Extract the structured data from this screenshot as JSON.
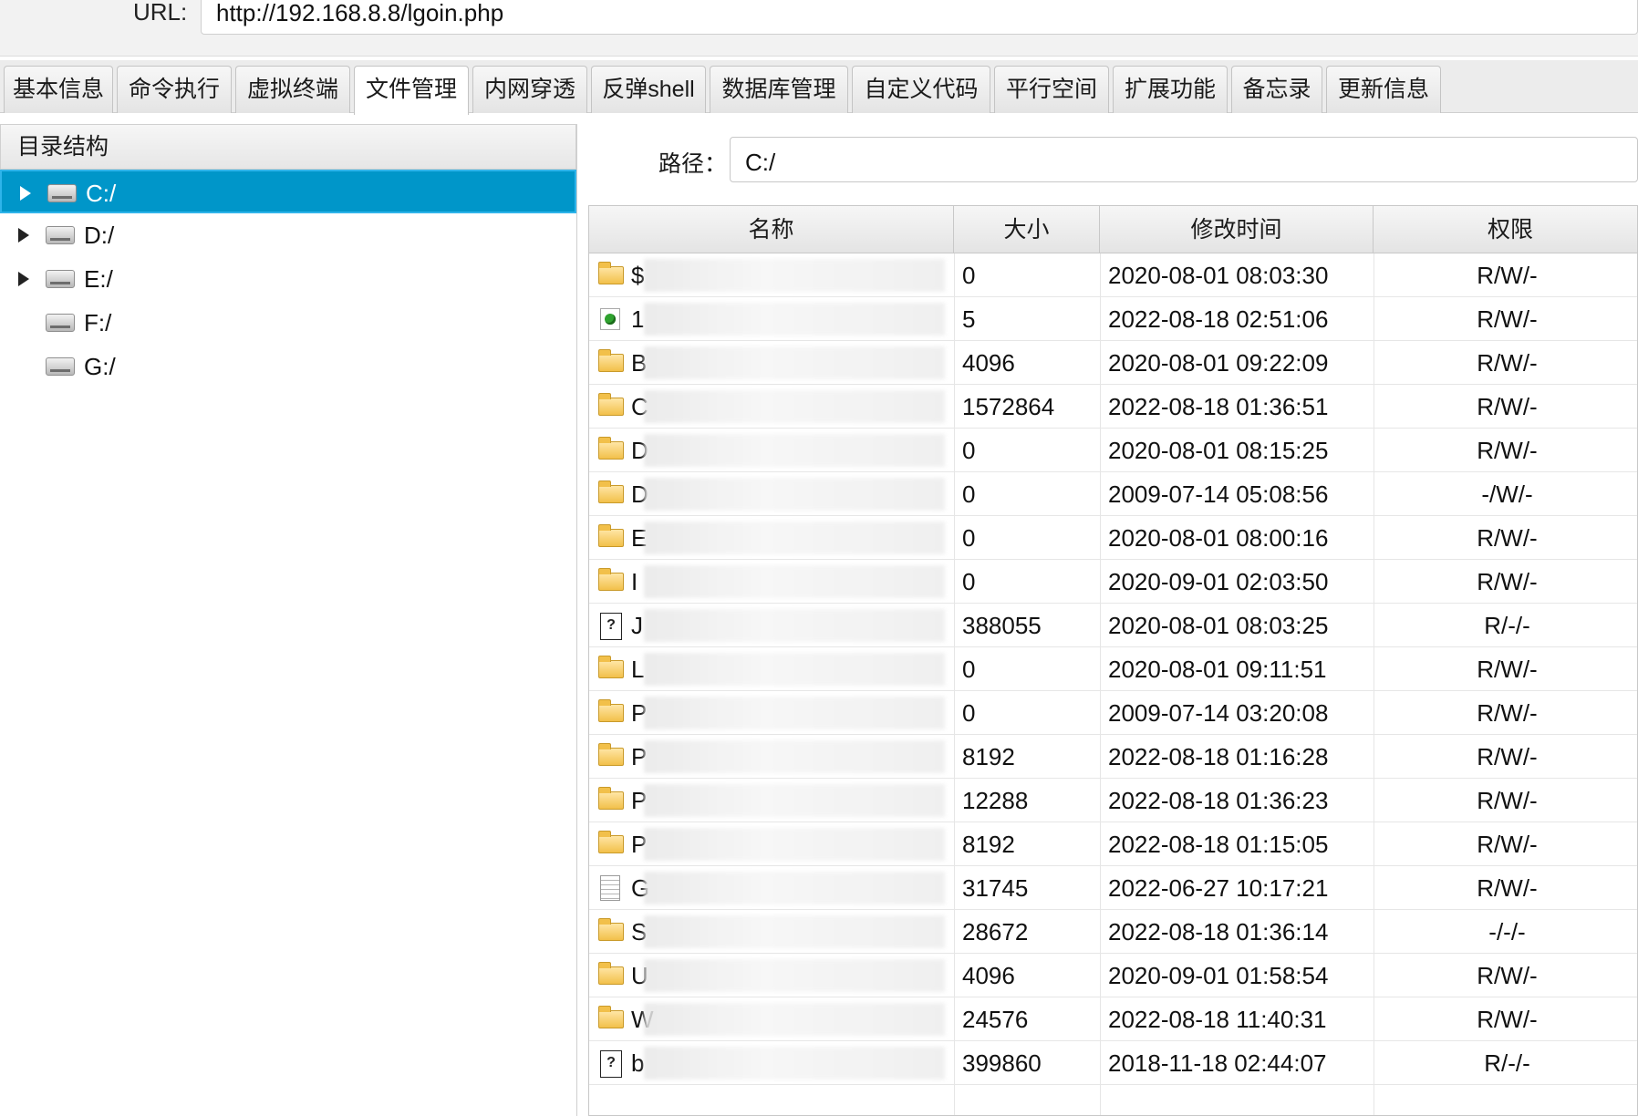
{
  "url_bar": {
    "label": "URL:",
    "value": "http://192.168.8.8/lgoin.php"
  },
  "tabs": [
    {
      "label": "基本信息"
    },
    {
      "label": "命令执行"
    },
    {
      "label": "虚拟终端"
    },
    {
      "label": "文件管理",
      "active": true
    },
    {
      "label": "内网穿透"
    },
    {
      "label": "反弹shell"
    },
    {
      "label": "数据库管理"
    },
    {
      "label": "自定义代码"
    },
    {
      "label": "平行空间"
    },
    {
      "label": "扩展功能"
    },
    {
      "label": "备忘录"
    },
    {
      "label": "更新信息"
    }
  ],
  "tree": {
    "header": "目录结构",
    "items": [
      {
        "label": "C:/",
        "selected": true,
        "expandable": true
      },
      {
        "label": "D:/",
        "expandable": true
      },
      {
        "label": "E:/",
        "expandable": true
      },
      {
        "label": "F:/",
        "expandable": false
      },
      {
        "label": "G:/",
        "expandable": false
      }
    ]
  },
  "path": {
    "label": "路径：",
    "value": "C:/"
  },
  "table": {
    "columns": [
      "名称",
      "大小",
      "修改时间",
      "权限"
    ],
    "rows": [
      {
        "icon": "folder-icon",
        "name": "$",
        "size": "0",
        "time": "2020-08-01 08:03:30",
        "perm": "R/W/-"
      },
      {
        "icon": "green-file-icon",
        "name": "1",
        "size": "5",
        "time": "2022-08-18 02:51:06",
        "perm": "R/W/-"
      },
      {
        "icon": "folder-icon",
        "name": "B",
        "size": "4096",
        "time": "2020-08-01 09:22:09",
        "perm": "R/W/-"
      },
      {
        "icon": "folder-icon",
        "name": "C",
        "size": "1572864",
        "time": "2022-08-18 01:36:51",
        "perm": "R/W/-"
      },
      {
        "icon": "folder-icon",
        "name": "D",
        "size": "0",
        "time": "2020-08-01 08:15:25",
        "perm": "R/W/-"
      },
      {
        "icon": "folder-icon",
        "name": "D",
        "size": "0",
        "time": "2009-07-14 05:08:56",
        "perm": "-/W/-"
      },
      {
        "icon": "folder-icon",
        "name": "E",
        "size": "0",
        "time": "2020-08-01 08:00:16",
        "perm": "R/W/-"
      },
      {
        "icon": "folder-icon",
        "name": "I",
        "size": "0",
        "time": "2020-09-01 02:03:50",
        "perm": "R/W/-"
      },
      {
        "icon": "unknown-file-icon",
        "name": "J",
        "size": "388055",
        "time": "2020-08-01 08:03:25",
        "perm": "R/-/-"
      },
      {
        "icon": "folder-icon",
        "name": "L",
        "size": "0",
        "time": "2020-08-01 09:11:51",
        "perm": "R/W/-"
      },
      {
        "icon": "folder-icon",
        "name": "P",
        "size": "0",
        "time": "2009-07-14 03:20:08",
        "perm": "R/W/-"
      },
      {
        "icon": "folder-icon",
        "name": "P",
        "size": "8192",
        "time": "2022-08-18 01:16:28",
        "perm": "R/W/-"
      },
      {
        "icon": "folder-icon",
        "name": "P",
        "size": "12288",
        "time": "2022-08-18 01:36:23",
        "perm": "R/W/-"
      },
      {
        "icon": "folder-icon",
        "name": "P",
        "size": "8192",
        "time": "2022-08-18 01:15:05",
        "perm": "R/W/-"
      },
      {
        "icon": "text-file-icon",
        "name": "G",
        "size": "31745",
        "time": "2022-06-27 10:17:21",
        "perm": "R/W/-"
      },
      {
        "icon": "folder-icon",
        "name": "S",
        "size": "28672",
        "time": "2022-08-18 01:36:14",
        "perm": "-/-/-"
      },
      {
        "icon": "folder-icon",
        "name": "U",
        "size": "4096",
        "time": "2020-09-01 01:58:54",
        "perm": "R/W/-"
      },
      {
        "icon": "folder-icon",
        "name": "W",
        "size": "24576",
        "time": "2022-08-18 11:40:31",
        "perm": "R/W/-"
      },
      {
        "icon": "unknown-file-icon",
        "name": "b",
        "size": "399860",
        "time": "2018-11-18 02:44:07",
        "perm": "R/-/-"
      }
    ]
  },
  "colors": {
    "selected_bg": "#0096c9",
    "folder": "#f2c04a"
  }
}
